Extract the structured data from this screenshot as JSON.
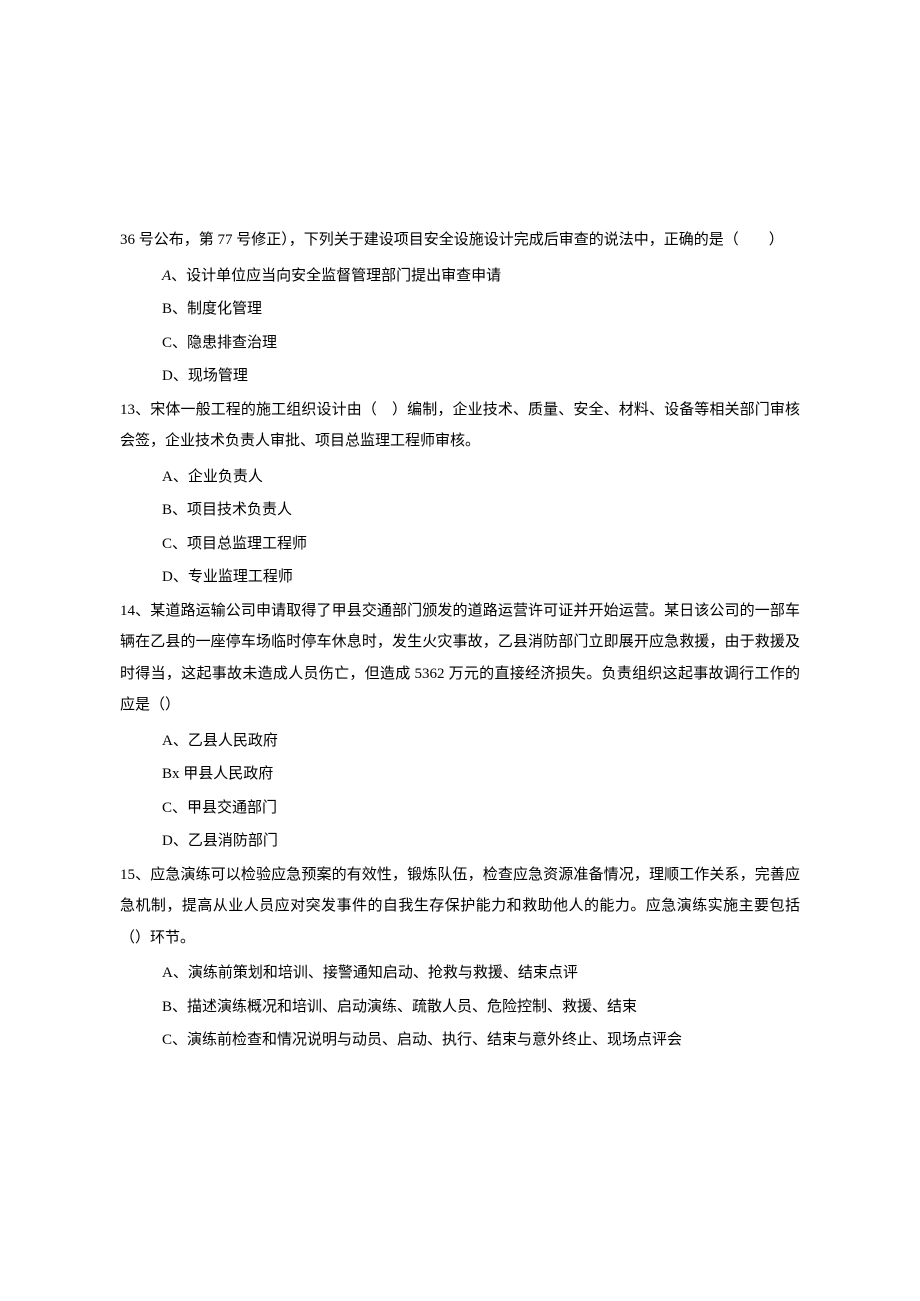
{
  "q12_trail": {
    "line1": "36 号公布，第 77 号修正），下列关于建设项目安全设施设计完成后审查的说法中，正确的是（　　）",
    "optA_prefix": "A",
    "optA_text": "、设计单位应当向安全监督管理部门提出审查申请",
    "optB": "B、制度化管理",
    "optC": "C、隐患排查治理",
    "optD": "D、现场管理"
  },
  "q13": {
    "stem": "13、宋体一般工程的施工组织设计由（　）编制，企业技术、质量、安全、材料、设备等相关部门审核会签，企业技术负责人审批、项目总监理工程师审核。",
    "optA": "A、企业负责人",
    "optB": "B、项目技术负责人",
    "optC": "C、项目总监理工程师",
    "optD": "D、专业监理工程师"
  },
  "q14": {
    "stem": "14、某道路运输公司申请取得了甲县交通部门颁发的道路运营许可证并开始运营。某日该公司的一部车辆在乙县的一座停车场临时停车休息时，发生火灾事故，乙县消防部门立即展开应急救援，由于救援及时得当，这起事故未造成人员伤亡，但造成 5362 万元的直接经济损失。负责组织这起事故调行工作的应是（）",
    "optA": "A、乙县人民政府",
    "optB": "Bx 甲县人民政府",
    "optC": "C、甲县交通部门",
    "optD": "D、乙县消防部门"
  },
  "q15": {
    "stem": "15、应急演练可以检验应急预案的有效性，锻炼队伍，检查应急资源准备情况，理顺工作关系，完善应急机制，提高从业人员应对突发事件的自我生存保护能力和救助他人的能力。应急演练实施主要包括（）环节。",
    "optA": "A、演练前策划和培训、接警通知启动、抢救与救援、结束点评",
    "optB": "B、描述演练概况和培训、启动演练、疏散人员、危险控制、救援、结束",
    "optC": "C、演练前检查和情况说明与动员、启动、执行、结束与意外终止、现场点评会"
  }
}
